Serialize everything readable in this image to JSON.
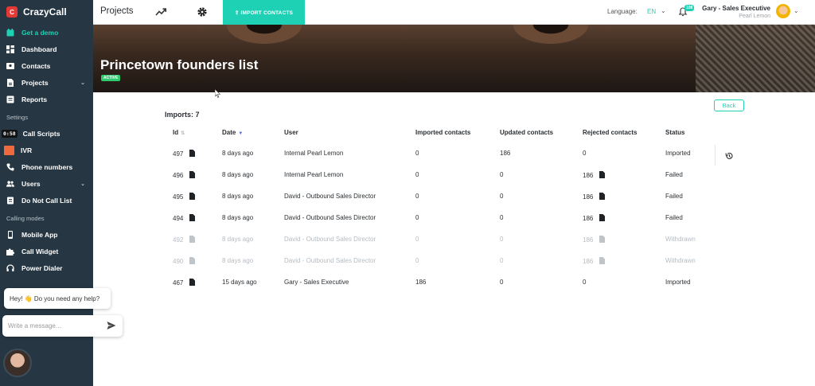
{
  "brand": {
    "logo_letter": "C",
    "name": "CrazyCall"
  },
  "sidebar": {
    "demo": {
      "label": "Get a demo",
      "icon": "calendar-check-icon"
    },
    "items": [
      {
        "label": "Dashboard",
        "icon": "dashboard-icon"
      },
      {
        "label": "Contacts",
        "icon": "contacts-icon"
      },
      {
        "label": "Projects",
        "icon": "projects-icon",
        "chevron": "⌄"
      },
      {
        "label": "Reports",
        "icon": "reports-icon"
      }
    ],
    "settings_heading": "Settings",
    "settings_items": [
      {
        "label": "Call Scripts",
        "badge": "0:58"
      },
      {
        "label": "IVR"
      },
      {
        "label": "Phone numbers",
        "icon": "phone-icon"
      },
      {
        "label": "Users",
        "icon": "users-icon",
        "chevron": "⌄"
      },
      {
        "label": "Do Not Call List",
        "icon": "block-list-icon"
      }
    ],
    "calling_heading": "Calling modes",
    "calling_items": [
      {
        "label": "Mobile App",
        "icon": "mobile-icon"
      },
      {
        "label": "Call Widget",
        "icon": "puzzle-icon"
      },
      {
        "label": "Power Dialer",
        "icon": "headset-icon"
      }
    ]
  },
  "chat": {
    "greeting": "Hey! 👋 Do you need any help?",
    "placeholder": "Write a message..."
  },
  "topbar": {
    "title": "Projects",
    "import_label": "⇪ IMPORT CONTACTS",
    "language_label": "Language:",
    "language_value": "EN",
    "notification_count": "108",
    "user_name": "Gary - Sales Executive",
    "user_company": "Pearl Lemon"
  },
  "hero": {
    "title": "Princetown founders list",
    "status": "ACTIVE"
  },
  "imports": {
    "count_label": "Imports: 7",
    "back_label": "Back",
    "columns": {
      "id": "Id",
      "date": "Date",
      "user": "User",
      "imported": "Imported contacts",
      "updated": "Updated contacts",
      "rejected": "Rejected contacts",
      "status": "Status"
    },
    "rows": [
      {
        "id": "497",
        "date": "8 days ago",
        "user": "Internal Pearl Lemon",
        "imported": "0",
        "updated": "186",
        "rejected": "0",
        "status": "Imported",
        "rejected_file": false,
        "muted": false
      },
      {
        "id": "496",
        "date": "8 days ago",
        "user": "Internal Pearl Lemon",
        "imported": "0",
        "updated": "0",
        "rejected": "186",
        "status": "Failed",
        "rejected_file": true,
        "muted": false
      },
      {
        "id": "495",
        "date": "8 days ago",
        "user": "David - Outbound Sales Director",
        "imported": "0",
        "updated": "0",
        "rejected": "186",
        "status": "Failed",
        "rejected_file": true,
        "muted": false
      },
      {
        "id": "494",
        "date": "8 days ago",
        "user": "David - Outbound Sales Director",
        "imported": "0",
        "updated": "0",
        "rejected": "186",
        "status": "Failed",
        "rejected_file": true,
        "muted": false
      },
      {
        "id": "492",
        "date": "8 days ago",
        "user": "David - Outbound Sales Director",
        "imported": "0",
        "updated": "0",
        "rejected": "186",
        "status": "Withdrawn",
        "rejected_file": true,
        "muted": true
      },
      {
        "id": "490",
        "date": "8 days ago",
        "user": "David - Outbound Sales Director",
        "imported": "0",
        "updated": "0",
        "rejected": "186",
        "status": "Withdrawn",
        "rejected_file": true,
        "muted": true
      },
      {
        "id": "467",
        "date": "15 days ago",
        "user": "Gary - Sales Executive",
        "imported": "186",
        "updated": "0",
        "rejected": "0",
        "status": "Imported",
        "rejected_file": false,
        "muted": false
      }
    ]
  },
  "colors": {
    "accent": "#1fd1b4",
    "sidebar": "#263642",
    "active_badge": "#2ecc71",
    "brand_red": "#e53935"
  }
}
